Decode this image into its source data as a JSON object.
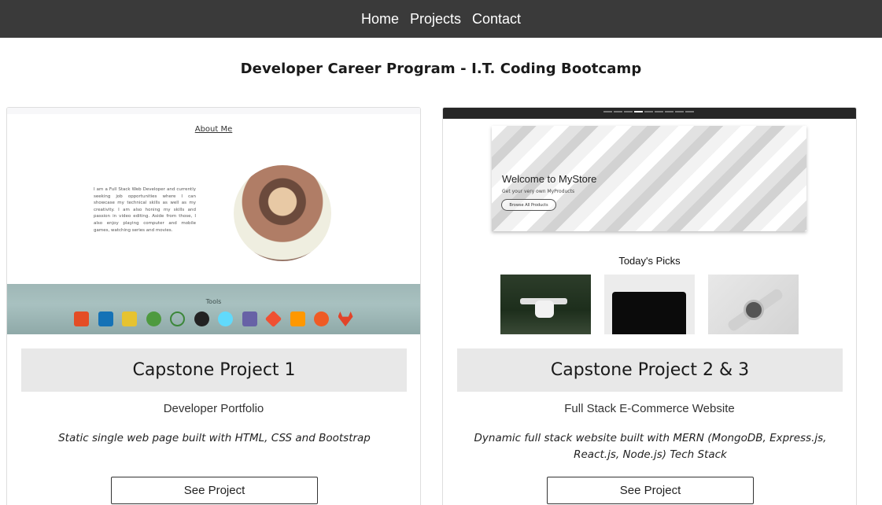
{
  "nav": {
    "items": [
      {
        "label": "Home"
      },
      {
        "label": "Projects"
      },
      {
        "label": "Contact"
      }
    ]
  },
  "program_title": "Developer Career Program - I.T. Coding Bootcamp",
  "projects": [
    {
      "title": "Capstone Project 1",
      "subtitle": "Developer Portfolio",
      "description": "Static single web page built with HTML, CSS and Bootstrap",
      "button_label": "See Project",
      "preview": {
        "about_label": "About Me",
        "bio": "I am a Full Stack Web Developer and currently seeking job opportunities where I can showcase my technical skills as well as my creativity. I am also honing my skills and passion in video editing. Aside from those, I also enjoy playing computer and mobile games, watching series and movies.",
        "tools_label": "Tools",
        "tools_icons": [
          "html5-icon",
          "css3-icon",
          "javascript-icon",
          "mongodb-icon",
          "nodejs-icon",
          "express-icon",
          "react-icon",
          "heroku-icon",
          "git-icon",
          "sublime-icon",
          "postman-icon",
          "gitlab-icon"
        ]
      }
    },
    {
      "title": "Capstone Project 2 & 3",
      "subtitle": "Full Stack E-Commerce Website",
      "description": "Dynamic full stack website built with MERN (MongoDB, Express.js, React.js, Node.js) Tech Stack",
      "button_label": "See Project",
      "preview": {
        "welcome": "Welcome to MyStore",
        "tagline": "Get your very own MyProducts",
        "browse_label": "Browse All Products",
        "picks_label": "Today's Picks"
      }
    }
  ],
  "colors": {
    "navbar": "#3a3a3a",
    "title_box": "#e8e8e8",
    "tools_bg": "#9fb7b6"
  }
}
